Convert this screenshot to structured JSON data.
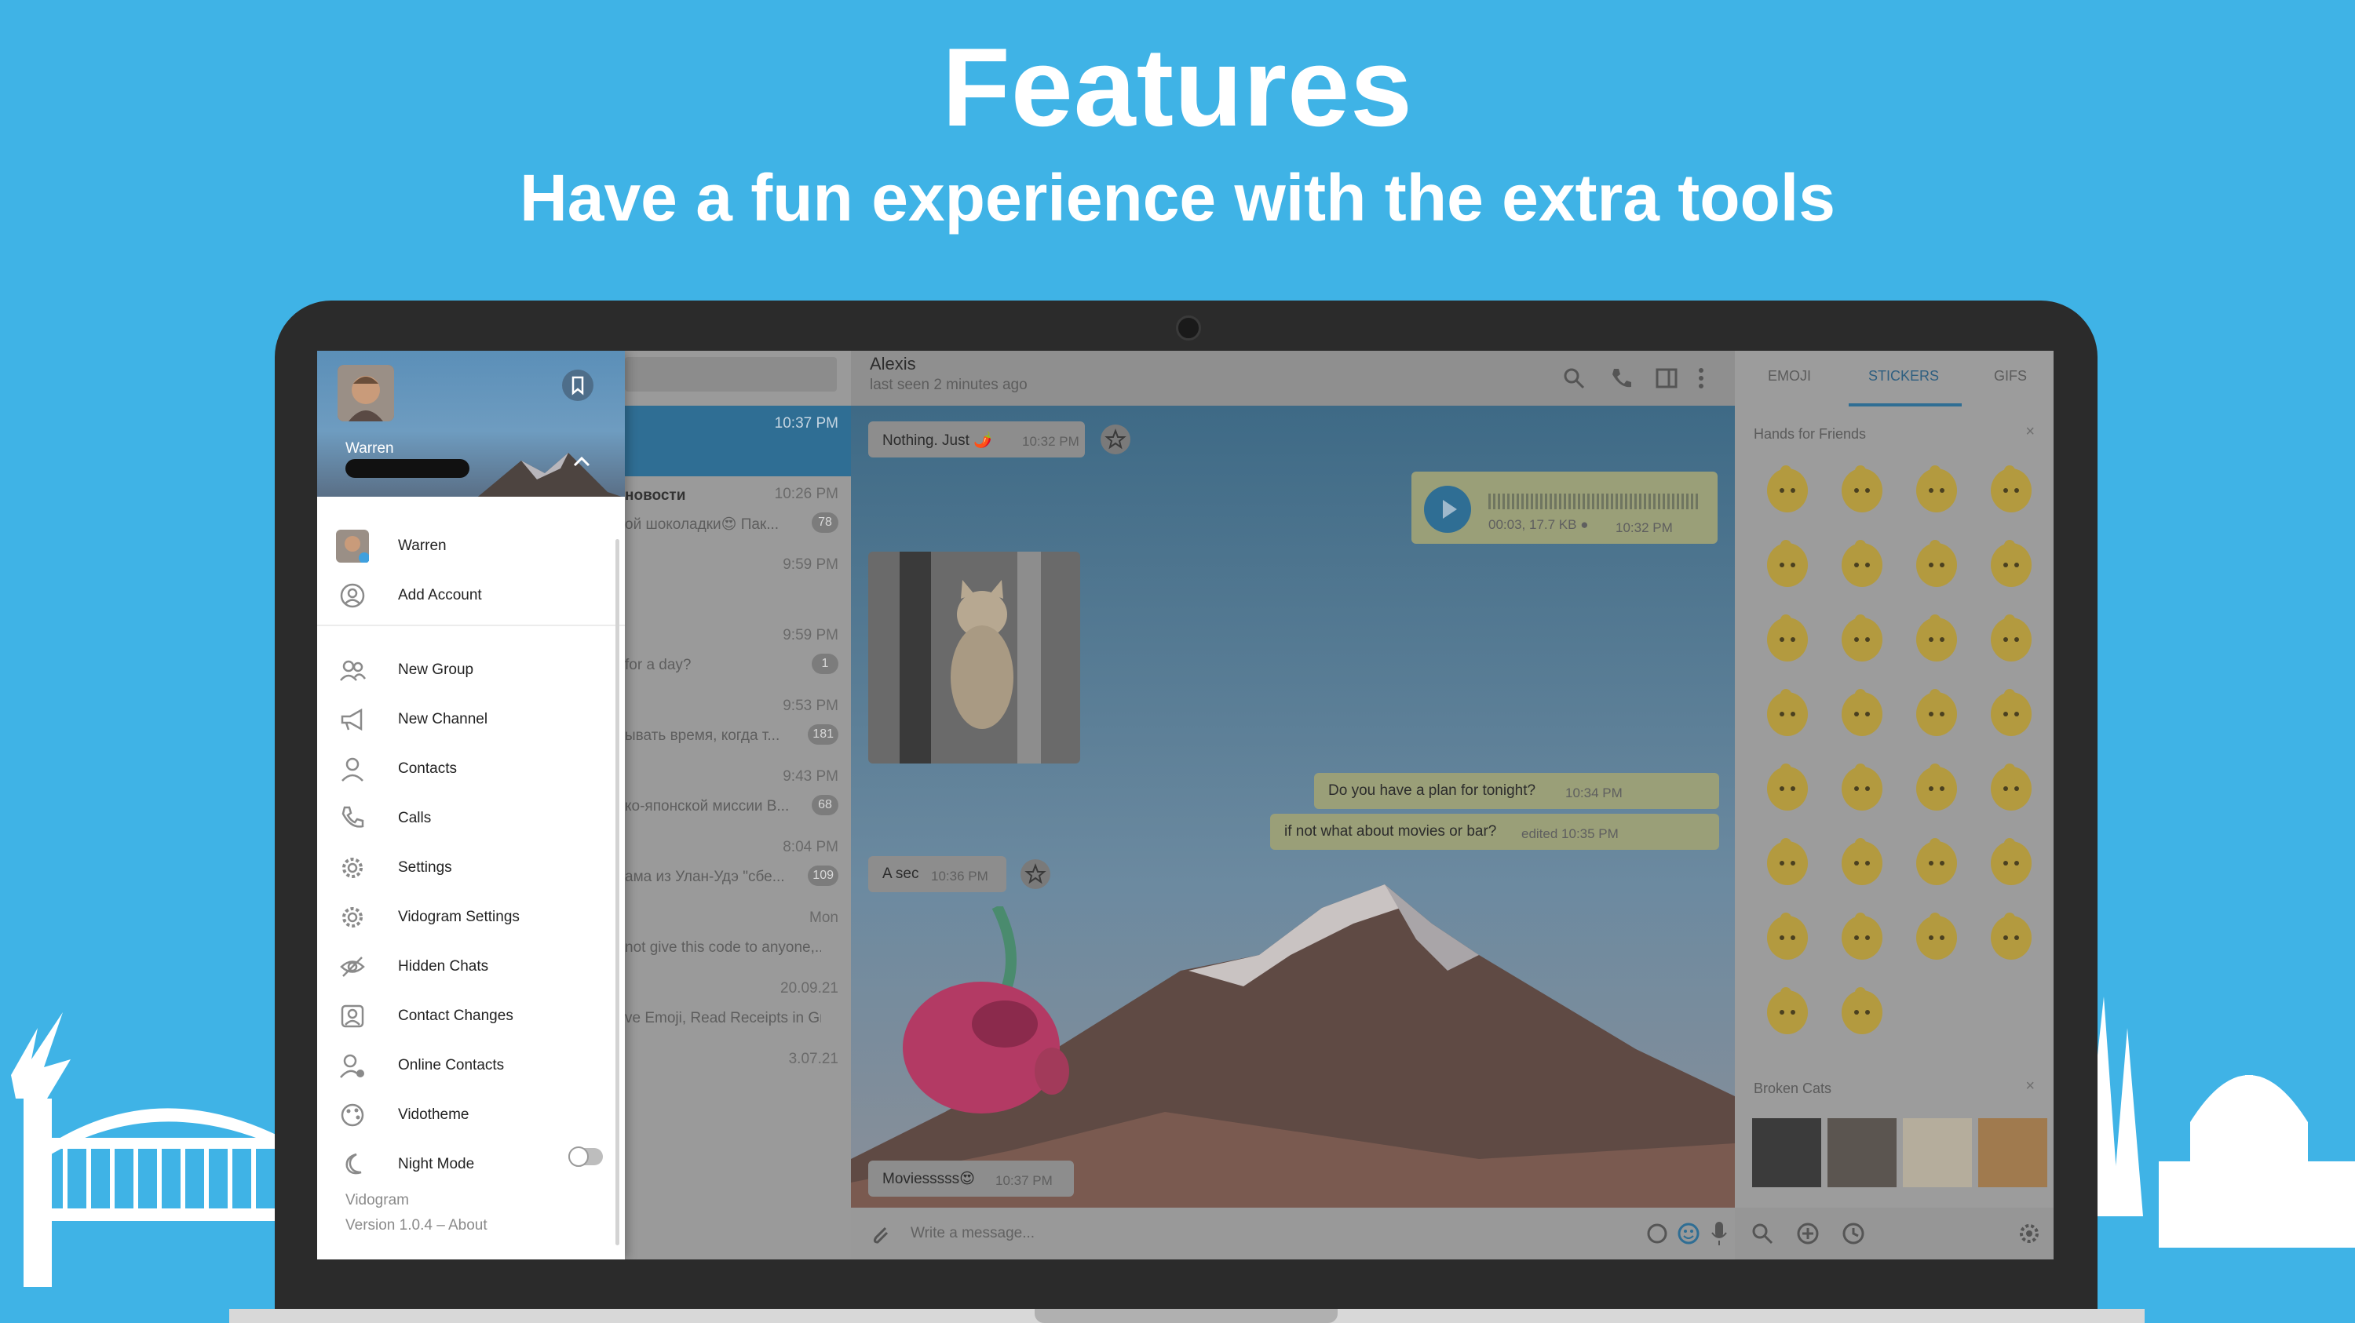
{
  "hero": {
    "title": "Features",
    "subtitle": "Have a fun experience with the extra tools"
  },
  "drawer": {
    "account_name": "Warren",
    "accounts": [
      {
        "name": "Warren"
      },
      {
        "name": "Add Account"
      }
    ],
    "menu": [
      {
        "label": "New Group",
        "icon": "group-icon"
      },
      {
        "label": "New Channel",
        "icon": "megaphone-icon"
      },
      {
        "label": "Contacts",
        "icon": "person-icon"
      },
      {
        "label": "Calls",
        "icon": "phone-icon"
      },
      {
        "label": "Settings",
        "icon": "gear-icon"
      },
      {
        "label": "Vidogram Settings",
        "icon": "gear-icon"
      },
      {
        "label": "Hidden Chats",
        "icon": "hidden-eye-icon"
      },
      {
        "label": "Contact Changes",
        "icon": "contact-changes-icon"
      },
      {
        "label": "Online Contacts",
        "icon": "online-contacts-icon"
      },
      {
        "label": "Vidotheme",
        "icon": "palette-icon"
      },
      {
        "label": "Night Mode",
        "icon": "moon-icon",
        "toggle": false
      }
    ],
    "footer_app": "Vidogram",
    "footer_version": "Version 1.0.4 – About"
  },
  "chat_list": {
    "rows": [
      {
        "time": "10:37 PM",
        "title": "",
        "preview": "",
        "badge": ""
      },
      {
        "time": "10:26 PM",
        "title": "новости",
        "preview": "ой шоколадки😍  Пак...",
        "badge": "78"
      },
      {
        "time": "9:59 PM",
        "title": "",
        "preview": "",
        "badge": ""
      },
      {
        "time": "9:59 PM",
        "title": "",
        "preview": "for a day?",
        "badge": "1"
      },
      {
        "time": "9:53 PM",
        "title": "",
        "preview": "ывать время, когда т...",
        "badge": "181"
      },
      {
        "time": "9:43 PM",
        "title": "",
        "preview": "ко-японской миссии  В...",
        "badge": "68"
      },
      {
        "time": "8:04 PM",
        "title": "",
        "preview": "ама из Улан-Удэ \"сбе...",
        "badge": "109"
      },
      {
        "time": "Mon",
        "title": "",
        "preview": "not give this code to anyone,...",
        "badge": ""
      },
      {
        "time": "20.09.21",
        "title": "",
        "preview": "ve Emoji, Read Receipts in Gr...",
        "badge": ""
      },
      {
        "time": "3.07.21",
        "title": "",
        "preview": "",
        "badge": ""
      }
    ]
  },
  "chat": {
    "name": "Alexis",
    "status": "last seen 2 minutes ago",
    "input_placeholder": "Write a message...",
    "messages": {
      "m1_text": "Nothing. Just 🌶️",
      "m1_time": "10:32 PM",
      "voice_meta": "00:03, 17.7 KB ●",
      "voice_time": "10:32 PM",
      "m2_text": "Do you have a plan for tonight?",
      "m2_time": "10:34 PM",
      "m3_text": "if not what about movies or bar?",
      "m3_time": "edited 10:35 PM",
      "m4_text": "A sec",
      "m4_time": "10:36 PM",
      "m5_text": "Moviesssss😍",
      "m5_time": "10:37 PM"
    }
  },
  "panel": {
    "tabs": [
      "EMOJI",
      "STICKERS",
      "GIFS"
    ],
    "active_tab": "STICKERS",
    "section1": "Hands for Friends",
    "section2": "Broken Cats",
    "close": "×"
  },
  "colors": {
    "background": "#3fb3e6",
    "laptop": "#2b2b2b",
    "accent": "#2f6e94"
  }
}
